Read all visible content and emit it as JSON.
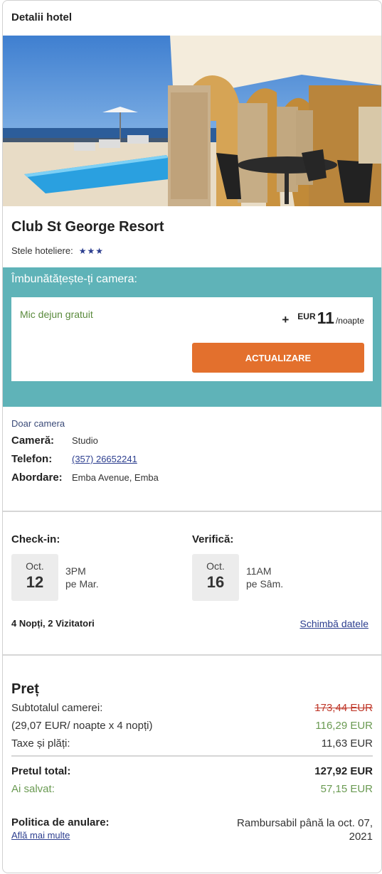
{
  "header": {
    "title": "Detalii hotel"
  },
  "hotel": {
    "name": "Club St George Resort",
    "stars_label": "Stele hoteliere:",
    "stars": "★★★",
    "star_count": 3
  },
  "upgrade": {
    "title": "Îmbunătățește-ți camera:",
    "item": "Mic dejun gratuit",
    "plus": "+",
    "currency": "EUR",
    "amount": "11",
    "per": "/noapte",
    "button_label": "ACTUALIZARE"
  },
  "room": {
    "type": "Doar camera",
    "room_label": "Cameră:",
    "room_value": "Studio",
    "phone_label": "Telefon:",
    "phone_value": "(357) 26652241",
    "address_label": "Abordare:",
    "address_value": "Emba Avenue, Emba"
  },
  "dates": {
    "checkin": {
      "title": "Check-in:",
      "month": "Oct.",
      "day": "12",
      "time": "3PM",
      "weekday": "pe Mar."
    },
    "checkout": {
      "title": "Verifică:",
      "month": "Oct.",
      "day": "16",
      "time": "11AM",
      "weekday": "pe Sâm."
    },
    "summary": "4 Nopți, 2 Vizitatori",
    "change_label": "Schimbă datele"
  },
  "price": {
    "title": "Preț",
    "subtotal_label": "Subtotalul camerei:",
    "subtotal_old": "173,44 EUR",
    "per_night_label": "(29,07 EUR/ noapte x 4 nopți)",
    "per_night_value": "116,29 EUR",
    "taxes_label": "Taxe și plăți:",
    "taxes_value": "11,63 EUR",
    "total_label": "Pretul total:",
    "total_value": "127,92 EUR",
    "saved_label": "Ai salvat:",
    "saved_value": "57,15 EUR",
    "policy_title": "Politica de anulare:",
    "policy_link": "Află mai multe",
    "policy_value": "Rambursabil până la oct. 07, 2021"
  },
  "colors": {
    "accent_teal": "#5fb3b8",
    "button_orange": "#e3702d",
    "link_blue": "#2c3e8f",
    "saved_green": "#6a9a52",
    "strike_red": "#c0392b"
  }
}
